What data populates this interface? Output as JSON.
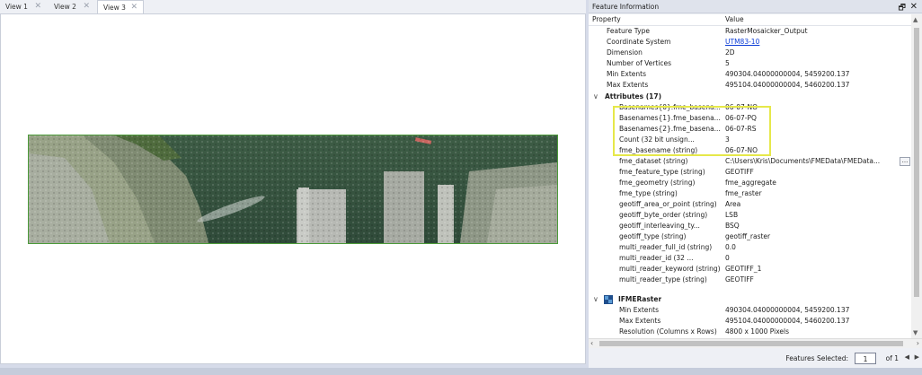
{
  "tabs": [
    {
      "label": "View 1",
      "active": false
    },
    {
      "label": "View 2",
      "active": false
    },
    {
      "label": "View 3",
      "active": true
    }
  ],
  "panel": {
    "title": "Feature Information",
    "pin_icon": "pin-icon",
    "close_icon": "close-icon"
  },
  "table": {
    "headers": {
      "property": "Property",
      "value": "Value"
    },
    "rows": [
      {
        "p": "Feature Type",
        "v": "RasterMosaicker_Output"
      },
      {
        "p": "Coordinate System",
        "v": "UTM83-10"
      },
      {
        "p": "Dimension",
        "v": "2D"
      },
      {
        "p": "Number of Vertices",
        "v": "5"
      },
      {
        "p": "Min Extents",
        "v": "490304.04000000004, 5459200.137"
      },
      {
        "p": "Max Extents",
        "v": "495104.04000000004, 5460200.137"
      }
    ],
    "attributes_title": "Attributes (17)",
    "attributes": [
      {
        "p": "Basenames{0}.fme_basena...",
        "v": "06-07-NO"
      },
      {
        "p": "Basenames{1}.fme_basena...",
        "v": "06-07-PQ"
      },
      {
        "p": "Basenames{2}.fme_basena...",
        "v": "06-07-RS"
      },
      {
        "p": "Count (32 bit unsign...",
        "v": "3"
      },
      {
        "p": "fme_basename (string)",
        "v": "06-07-NO"
      },
      {
        "p": "fme_dataset (string)",
        "v": "C:\\Users\\Kris\\Documents\\FMEData\\FMEData..."
      },
      {
        "p": "fme_feature_type (string)",
        "v": "GEOTIFF"
      },
      {
        "p": "fme_geometry (string)",
        "v": "fme_aggregate"
      },
      {
        "p": "fme_type (string)",
        "v": "fme_raster"
      },
      {
        "p": "geotiff_area_or_point (string)",
        "v": "Area"
      },
      {
        "p": "geotiff_byte_order (string)",
        "v": "LSB"
      },
      {
        "p": "geotiff_interleaving_ty...",
        "v": "BSQ"
      },
      {
        "p": "geotiff_type (string)",
        "v": "geotiff_raster"
      },
      {
        "p": "multi_reader_full_id (string)",
        "v": "0.0"
      },
      {
        "p": "multi_reader_id (32 ...",
        "v": "0"
      },
      {
        "p": "multi_reader_keyword (string)",
        "v": "GEOTIFF_1"
      },
      {
        "p": "multi_reader_type (string)",
        "v": "GEOTIFF"
      }
    ],
    "raster_title": "IFMERaster",
    "raster_rows": [
      {
        "p": "Min Extents",
        "v": "490304.04000000004, 5459200.137"
      },
      {
        "p": "Max Extents",
        "v": "495104.04000000004, 5460200.137"
      },
      {
        "p": "Resolution (Columns x Rows)",
        "v": "4800 x 1000 Pixels"
      }
    ],
    "ellipsis_label": "..."
  },
  "footer": {
    "label": "Features Selected:",
    "current": "1",
    "of": "of 1"
  },
  "colors": {
    "highlight": "#e6e84a",
    "link": "#0a3bd6",
    "raster_border": "#4c9a3a"
  }
}
